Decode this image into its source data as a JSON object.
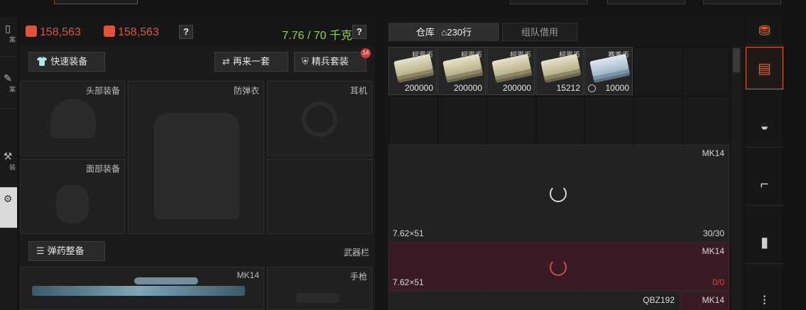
{
  "stats": {
    "value_a": "158,563",
    "value_b": "158,563",
    "help": "?",
    "weight": "7.76 / 70 千克",
    "weight_help": "?"
  },
  "left_nav": [
    {
      "icon": "folder-icon",
      "label": "案"
    },
    {
      "icon": "edit-icon",
      "label": "案"
    },
    {
      "icon": "wrench-icon",
      "label": "装"
    },
    {
      "icon": "gear-icon",
      "label": ""
    }
  ],
  "buttons": {
    "quick_equip": "快速装备",
    "repeat": "再来一套",
    "elite": "精兵套装",
    "elite_badge": "14",
    "ammo": "弹药整备"
  },
  "slots": {
    "head": "头部装备",
    "armor": "防弹衣",
    "headset": "耳机",
    "face": "面部装备",
    "weapon_bar": "武器栏",
    "primary": "MK14",
    "pistol": "手枪"
  },
  "storage": {
    "tab_warehouse": "仓库",
    "tab_rows": "230行",
    "tab_team": "组队借用",
    "items": [
      {
        "name": "柯恩币",
        "qty": "200000",
        "type": "cash"
      },
      {
        "name": "柯恩币",
        "qty": "200000",
        "type": "cash"
      },
      {
        "name": "柯恩币",
        "qty": "200000",
        "type": "cash"
      },
      {
        "name": "柯恩币",
        "qty": "15212",
        "type": "cash"
      },
      {
        "name": "赛季币",
        "qty": "10000",
        "type": "season"
      }
    ],
    "weapons": [
      {
        "name": "MK14",
        "caliber": "7.62×51",
        "ammo": "30/30",
        "state": "normal"
      },
      {
        "name": "MK14",
        "caliber": "7.62×51",
        "ammo": "0/0",
        "state": "red"
      },
      {
        "name": "MK14",
        "name2": "QBZ192",
        "state": "normal"
      }
    ]
  },
  "categories": [
    "currency-icon",
    "armor-icon",
    "gear-icon",
    "rifle-icon",
    "magazine-icon",
    "ammo-icon"
  ],
  "colors": {
    "accent": "#e0622a",
    "currency": "#e2533a",
    "weight": "#8fd13c",
    "alert": "#d63a3a"
  }
}
